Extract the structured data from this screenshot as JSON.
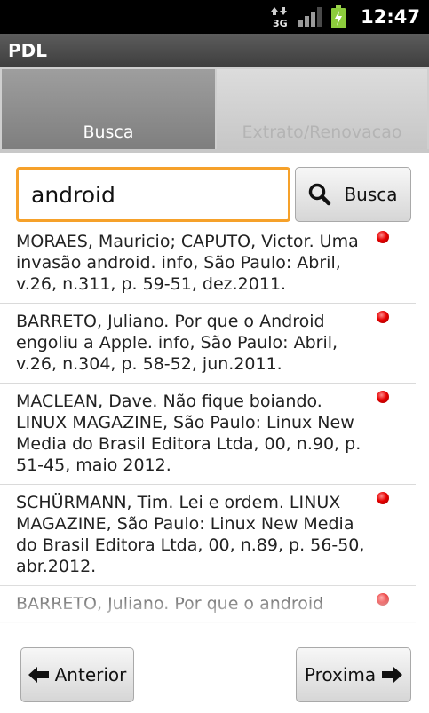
{
  "status_bar": {
    "time": "12:47",
    "network_type": "3G",
    "icons": [
      "network-3g-icon",
      "signal-icon",
      "battery-charging-icon"
    ]
  },
  "app": {
    "title": "PDL"
  },
  "tabs": [
    {
      "label": "Busca",
      "selected": true
    },
    {
      "label": "Extrato/Renovacao",
      "selected": false
    }
  ],
  "search": {
    "value": "android",
    "button_label": "Busca",
    "button_icon": "search-icon"
  },
  "results": [
    {
      "text": "MORAES, Mauricio; CAPUTO, Victor. Uma invasão android. info,  São Paulo: Abril, v.26, n.311, p. 59-51, dez.2011.",
      "status_color": "#e60000"
    },
    {
      "text": "BARRETO, Juliano. Por que o Android engoliu a Apple. info,  São Paulo: Abril, v.26, n.304, p. 58-52, jun.2011.",
      "status_color": "#e60000"
    },
    {
      "text": "MACLEAN, Dave. Não fique boiando. LINUX MAGAZINE,  São Paulo: Linux New Media do Brasil Editora Ltda, 00, n.90, p. 51-45, maio 2012.",
      "status_color": "#e60000"
    },
    {
      "text": "SCHÜRMANN, Tim. Lei e ordem. LINUX MAGAZINE,  São Paulo: Linux New Media do Brasil Editora Ltda, 00, n.89, p. 56-50, abr.2012.",
      "status_color": "#e60000"
    },
    {
      "text": "BARRETO, Juliano. Por que o android",
      "status_color": "#e60000"
    }
  ],
  "navigation": {
    "prev_label": "Anterior",
    "prev_icon": "arrow-left-icon",
    "next_label": "Proxima",
    "next_icon": "arrow-right-icon"
  },
  "colors": {
    "search_focus_border": "#f6a12a",
    "status_dot": "#e60000",
    "title_bar": "#4a4a4a"
  }
}
